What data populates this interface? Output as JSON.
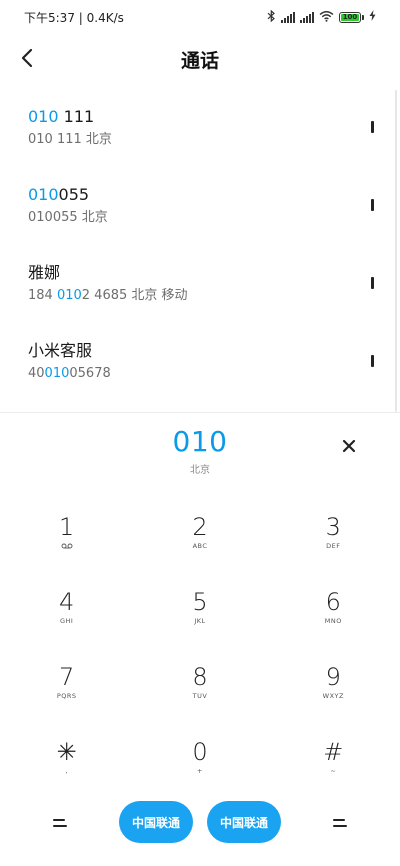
{
  "status_bar": {
    "time_speed": "下午5:37 | 0.4K/s",
    "battery_level": "100"
  },
  "header": {
    "title": "通话"
  },
  "results": [
    {
      "name_parts": [
        {
          "text": "010",
          "hl": true
        },
        {
          "text": " 111",
          "hl": false
        }
      ],
      "detail_parts": [
        {
          "text": "010 111 北京",
          "hl": false
        }
      ]
    },
    {
      "name_parts": [
        {
          "text": "010",
          "hl": true
        },
        {
          "text": "055",
          "hl": false
        }
      ],
      "detail_parts": [
        {
          "text": "010055 北京",
          "hl": false
        }
      ]
    },
    {
      "name_parts": [
        {
          "text": "雅娜",
          "hl": false
        }
      ],
      "detail_parts": [
        {
          "text": "184 ",
          "hl": false
        },
        {
          "text": "010",
          "hl": true
        },
        {
          "text": "2 4685 北京 移动",
          "hl": false
        }
      ]
    },
    {
      "name_parts": [
        {
          "text": "小米客服",
          "hl": false
        }
      ],
      "detail_parts": [
        {
          "text": "40",
          "hl": false
        },
        {
          "text": "010",
          "hl": true
        },
        {
          "text": "05678",
          "hl": false
        }
      ]
    }
  ],
  "dialpad": {
    "typed_number": "010",
    "location": "北京",
    "keys": [
      {
        "digit": "1",
        "letters": "",
        "icon": "voicemail-icon"
      },
      {
        "digit": "2",
        "letters": "ABC"
      },
      {
        "digit": "3",
        "letters": "DEF"
      },
      {
        "digit": "4",
        "letters": "GHI"
      },
      {
        "digit": "5",
        "letters": "JKL"
      },
      {
        "digit": "6",
        "letters": "MNO"
      },
      {
        "digit": "7",
        "letters": "PQRS"
      },
      {
        "digit": "8",
        "letters": "TUV"
      },
      {
        "digit": "9",
        "letters": "WXYZ"
      },
      {
        "digit": "✳",
        "letters": ","
      },
      {
        "digit": "0",
        "letters": "+"
      },
      {
        "digit": "#",
        "letters": "~"
      }
    ]
  },
  "bottom_bar": {
    "call_sim1_label": "中国联通",
    "call_sim2_label": "中国联通"
  },
  "colors": {
    "accent": "#0a9ae8",
    "call_button": "#1aa3f0",
    "battery": "#33c633"
  }
}
